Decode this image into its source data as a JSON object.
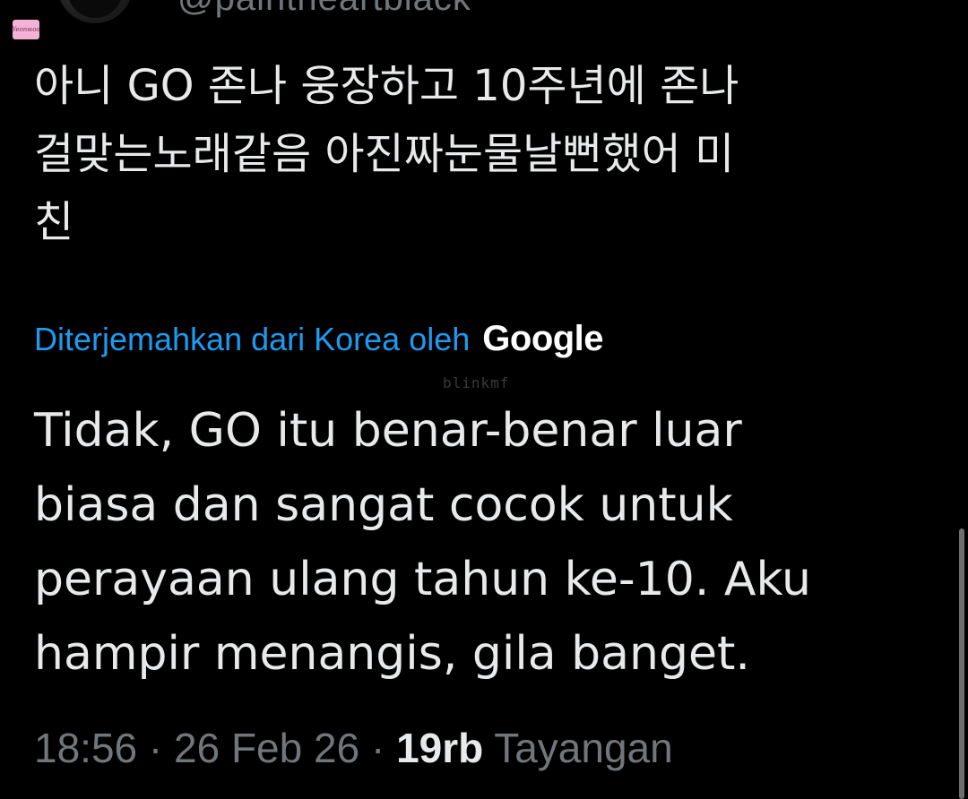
{
  "profile": {
    "handle": "@paintheartblack",
    "watermark_badge": "Yeonwoo"
  },
  "tweet": {
    "text_lines": [
      "아니 GO  존나 웅장하고 10주년에 존나",
      "걸맞는노래같음 아진짜눈물날뻔했어 미",
      "친"
    ],
    "translation_label": "Diterjemahkan dari Korea oleh",
    "translation_provider": "Google",
    "overlay_watermark": "blinkmf",
    "translated_lines": [
      "Tidak, GO itu benar-benar luar",
      "biasa dan sangat cocok untuk",
      "perayaan ulang tahun ke-10. Aku",
      "hampir menangis, gila banget."
    ]
  },
  "meta": {
    "time": "18:56",
    "separator": "·",
    "date": "26 Feb 26",
    "views_count": "19rb",
    "views_label": "Tayangan"
  },
  "colors": {
    "background": "#000000",
    "text_primary": "#e7e9ea",
    "text_secondary": "#71767b",
    "link": "#1d9bf0"
  }
}
